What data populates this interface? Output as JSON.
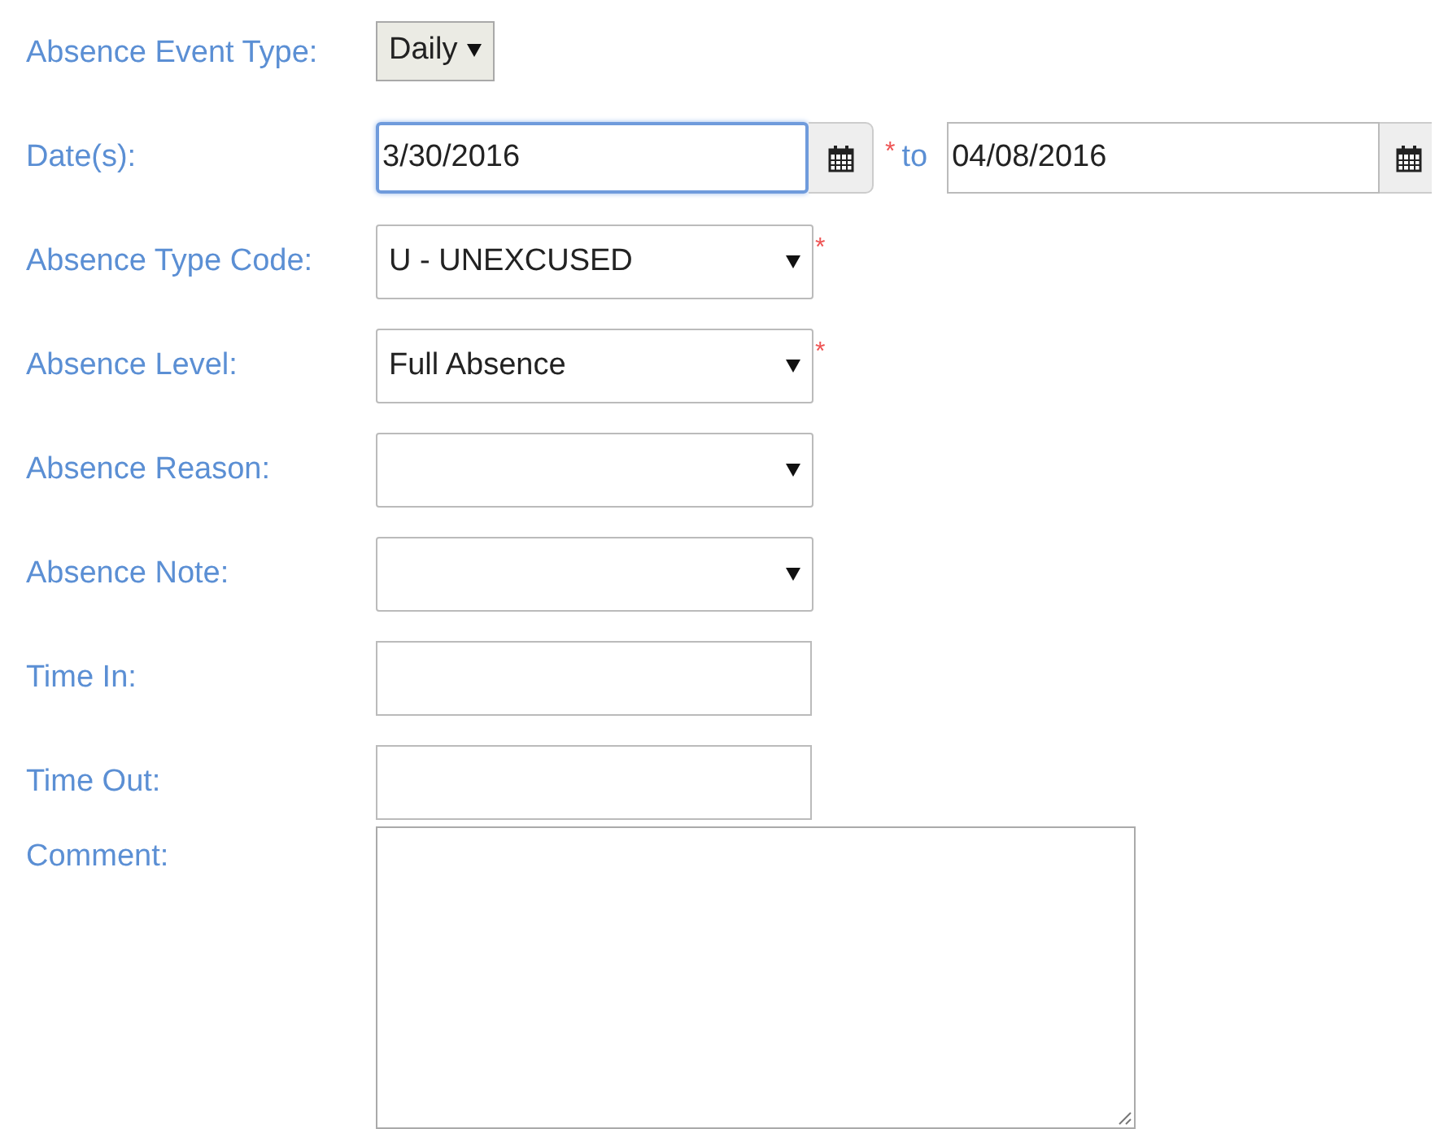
{
  "fields": [
    {
      "kind": "button-dropdown",
      "label": "Absence Event Type:",
      "value": "Daily"
    },
    {
      "kind": "date-range",
      "label": "Date(s):",
      "value": "3/30/2016",
      "focused": true,
      "required_mark": "*",
      "joiner": "to",
      "end_value": "04/08/2016"
    },
    {
      "kind": "dropdown",
      "label": "Absence Type Code:",
      "value": "U - UNEXCUSED",
      "required_mark": "*"
    },
    {
      "kind": "dropdown",
      "label": "Absence Level:",
      "value": "Full Absence",
      "required_mark": "*"
    },
    {
      "kind": "dropdown",
      "label": "Absence Reason:"
    },
    {
      "kind": "dropdown",
      "label": "Absence Note:"
    },
    {
      "kind": "text",
      "label": "Time In:"
    },
    {
      "kind": "text",
      "label": "Time Out:"
    },
    {
      "kind": "textarea",
      "label": "Comment:"
    }
  ]
}
